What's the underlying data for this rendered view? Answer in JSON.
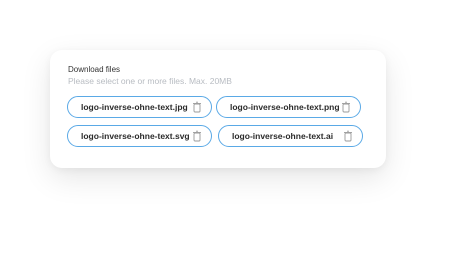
{
  "download": {
    "title": "Download files",
    "subtitle": "Please select one or more files. Max. 20MB",
    "files": [
      {
        "name": "logo-inverse-ohne-text.jpg",
        "icon": "trash-icon"
      },
      {
        "name": "logo-inverse-ohne-text.png",
        "icon": "trash-icon"
      },
      {
        "name": "logo-inverse-ohne-text.svg",
        "icon": "trash-icon"
      },
      {
        "name": "logo-inverse-ohne-text.ai",
        "icon": "trash-icon"
      }
    ]
  },
  "colors": {
    "chip_border": "#5aa9e6",
    "title_text": "#333333",
    "subtitle_text": "#b8bcc2",
    "file_text": "#2a2a2a",
    "icon": "#9a9a9a"
  }
}
